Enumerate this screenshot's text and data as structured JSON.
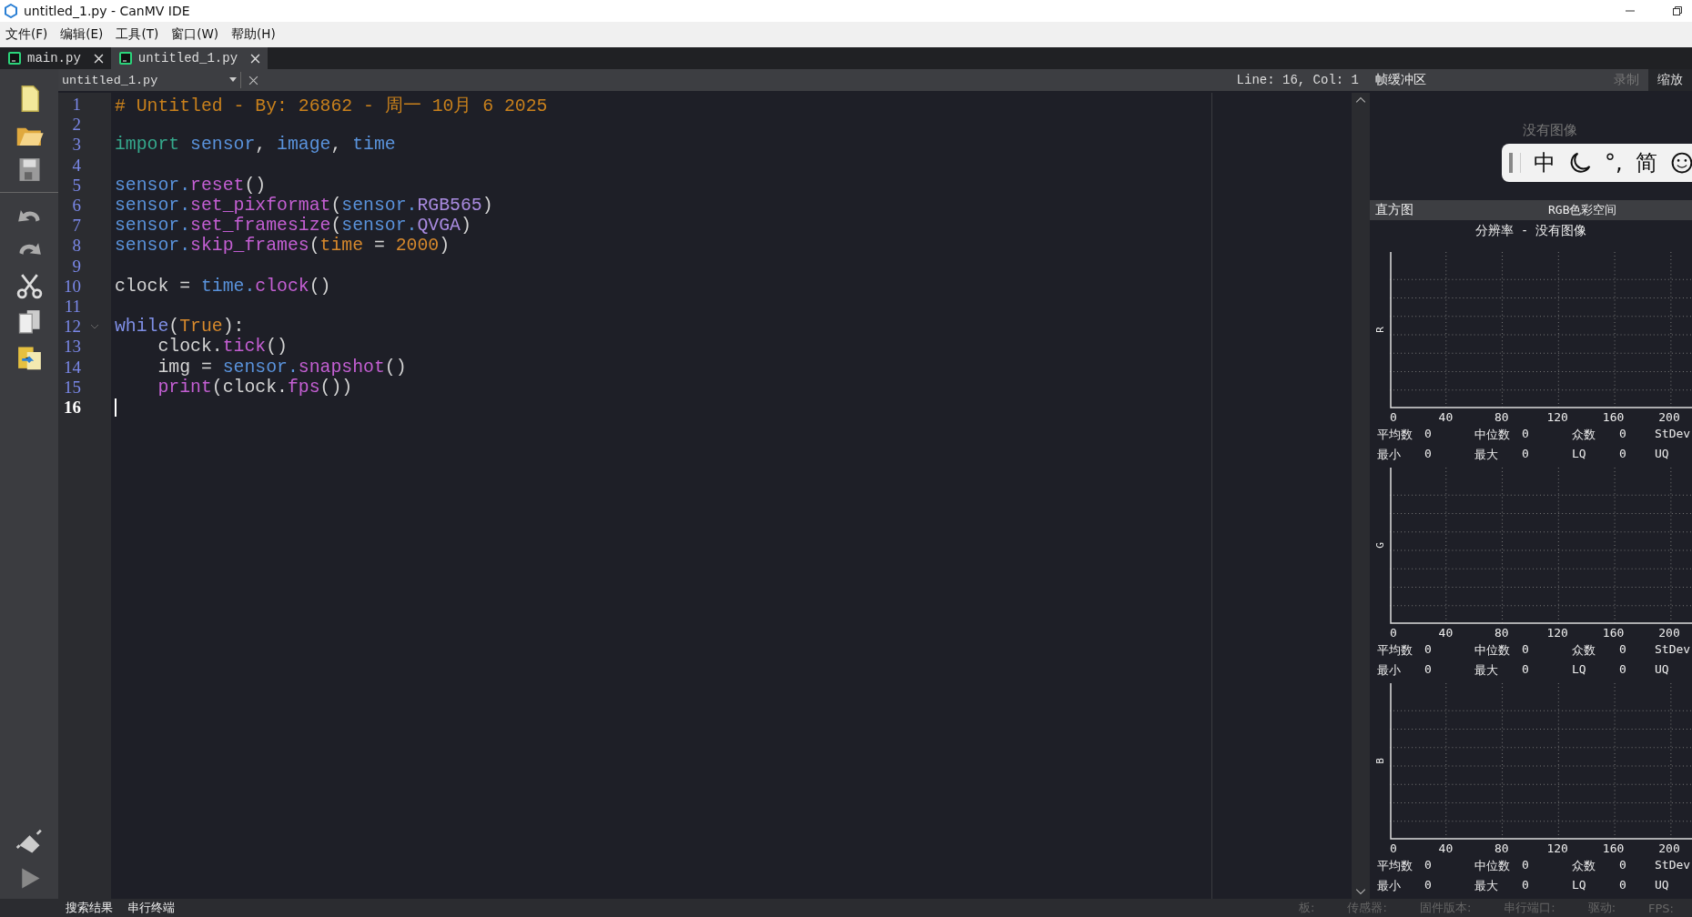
{
  "window": {
    "title": "untitled_1.py - CanMV IDE"
  },
  "menu": [
    "文件(F)",
    "编辑(E)",
    "工具(T)",
    "窗口(W)",
    "帮助(H)"
  ],
  "tabs": [
    {
      "label": "main.py",
      "selected": false
    },
    {
      "label": "untitled_1.py",
      "selected": true
    }
  ],
  "editor": {
    "file": "untitled_1.py",
    "position": "Line: 16, Col: 1",
    "lines": [
      {
        "number": "1",
        "tokens": [
          {
            "kind": "comment",
            "text": "# Untitled - By: 26862 - 周一 10月 6 2025"
          }
        ]
      },
      {
        "number": "2"
      },
      {
        "number": "3",
        "tokens": [
          {
            "kind": "keyword",
            "text": "import"
          },
          {
            "kind": "module",
            "text": " sensor"
          },
          {
            "kind": "plain",
            "text": ", "
          },
          {
            "kind": "module",
            "text": "image"
          },
          {
            "kind": "plain",
            "text": ", "
          },
          {
            "kind": "module",
            "text": "time"
          }
        ]
      },
      {
        "number": "4"
      },
      {
        "number": "5",
        "tokens": [
          {
            "kind": "module",
            "text": "sensor."
          },
          {
            "kind": "function",
            "text": "reset"
          },
          {
            "kind": "plain",
            "text": "()"
          }
        ]
      },
      {
        "number": "6",
        "tokens": [
          {
            "kind": "module",
            "text": "sensor."
          },
          {
            "kind": "function",
            "text": "set_pixformat"
          },
          {
            "kind": "plain",
            "text": "("
          },
          {
            "kind": "module",
            "text": "sensor."
          },
          {
            "kind": "attribute",
            "text": "RGB565"
          },
          {
            "kind": "plain",
            "text": ")"
          }
        ]
      },
      {
        "number": "7",
        "tokens": [
          {
            "kind": "module",
            "text": "sensor."
          },
          {
            "kind": "function",
            "text": "set_framesize"
          },
          {
            "kind": "plain",
            "text": "("
          },
          {
            "kind": "module",
            "text": "sensor."
          },
          {
            "kind": "attribute",
            "text": "QVGA"
          },
          {
            "kind": "plain",
            "text": ")"
          }
        ]
      },
      {
        "number": "8",
        "tokens": [
          {
            "kind": "module",
            "text": "sensor."
          },
          {
            "kind": "function",
            "text": "skip_frames"
          },
          {
            "kind": "plain",
            "text": "("
          },
          {
            "kind": "constant",
            "text": "time"
          },
          {
            "kind": "plain",
            "text": " = "
          },
          {
            "kind": "constant",
            "text": "2000"
          },
          {
            "kind": "plain",
            "text": ")"
          }
        ]
      },
      {
        "number": "9"
      },
      {
        "number": "10",
        "tokens": [
          {
            "kind": "plain",
            "text": "clock = "
          },
          {
            "kind": "module",
            "text": "time."
          },
          {
            "kind": "function",
            "text": "clock"
          },
          {
            "kind": "plain",
            "text": "()"
          }
        ]
      },
      {
        "number": "11"
      },
      {
        "number": "12",
        "foldable": true,
        "tokens": [
          {
            "kind": "control",
            "text": "while"
          },
          {
            "kind": "plain",
            "text": "("
          },
          {
            "kind": "constant",
            "text": "True"
          },
          {
            "kind": "plain",
            "text": "):"
          }
        ]
      },
      {
        "number": "13",
        "tokens": [
          {
            "kind": "plain",
            "text": "    clock."
          },
          {
            "kind": "function",
            "text": "tick"
          },
          {
            "kind": "plain",
            "text": "()"
          }
        ]
      },
      {
        "number": "14",
        "tokens": [
          {
            "kind": "plain",
            "text": "    img = "
          },
          {
            "kind": "module",
            "text": "sensor."
          },
          {
            "kind": "function",
            "text": "snapshot"
          },
          {
            "kind": "plain",
            "text": "()"
          }
        ]
      },
      {
        "number": "15",
        "tokens": [
          {
            "kind": "function",
            "text": "    print"
          },
          {
            "kind": "plain",
            "text": "(clock."
          },
          {
            "kind": "function",
            "text": "fps"
          },
          {
            "kind": "plain",
            "text": "())"
          }
        ]
      },
      {
        "number": "16",
        "current": true
      }
    ]
  },
  "frame_buffer": {
    "title": "帧缓冲区",
    "record": {
      "label": "录制",
      "disabled": true
    },
    "zoom": {
      "label": "缩放",
      "selected": true
    },
    "message": "没有图像"
  },
  "ime_toolbar": {
    "items": [
      "中",
      "°,",
      "简"
    ]
  },
  "histogram": {
    "title": "直方图",
    "color_space": "RGB色彩空间",
    "resolution": "分辨率 - 没有图像",
    "channels": [
      {
        "name": "R",
        "xticks": [
          "0",
          "40",
          "80",
          "120",
          "160",
          "200"
        ],
        "stats": [
          {
            "label": "平均数",
            "value": "0"
          },
          {
            "label": "中位数",
            "value": "0"
          },
          {
            "label": "众数",
            "value": "0"
          },
          {
            "label": "StDev"
          },
          {
            "label": "最小",
            "value": "0"
          },
          {
            "label": "最大",
            "value": "0"
          },
          {
            "label": "LQ",
            "value": "0"
          },
          {
            "label": "UQ"
          }
        ]
      },
      {
        "name": "G",
        "xticks": [
          "0",
          "40",
          "80",
          "120",
          "160",
          "200"
        ],
        "stats": [
          {
            "label": "平均数",
            "value": "0"
          },
          {
            "label": "中位数",
            "value": "0"
          },
          {
            "label": "众数",
            "value": "0"
          },
          {
            "label": "StDev"
          },
          {
            "label": "最小",
            "value": "0"
          },
          {
            "label": "最大",
            "value": "0"
          },
          {
            "label": "LQ",
            "value": "0"
          },
          {
            "label": "UQ"
          }
        ]
      },
      {
        "name": "B",
        "xticks": [
          "0",
          "40",
          "80",
          "120",
          "160",
          "200"
        ],
        "stats": [
          {
            "label": "平均数",
            "value": "0"
          },
          {
            "label": "中位数",
            "value": "0"
          },
          {
            "label": "众数",
            "value": "0"
          },
          {
            "label": "StDev"
          },
          {
            "label": "最小",
            "value": "0"
          },
          {
            "label": "最大",
            "value": "0"
          },
          {
            "label": "LQ",
            "value": "0"
          },
          {
            "label": "UQ"
          }
        ]
      }
    ]
  },
  "bottom_tabs": [
    "搜索结果",
    "串行终端"
  ],
  "status_bar": [
    "板:",
    "传感器:",
    "固件版本:",
    "串行端口:",
    "驱动:",
    "FPS:"
  ]
}
